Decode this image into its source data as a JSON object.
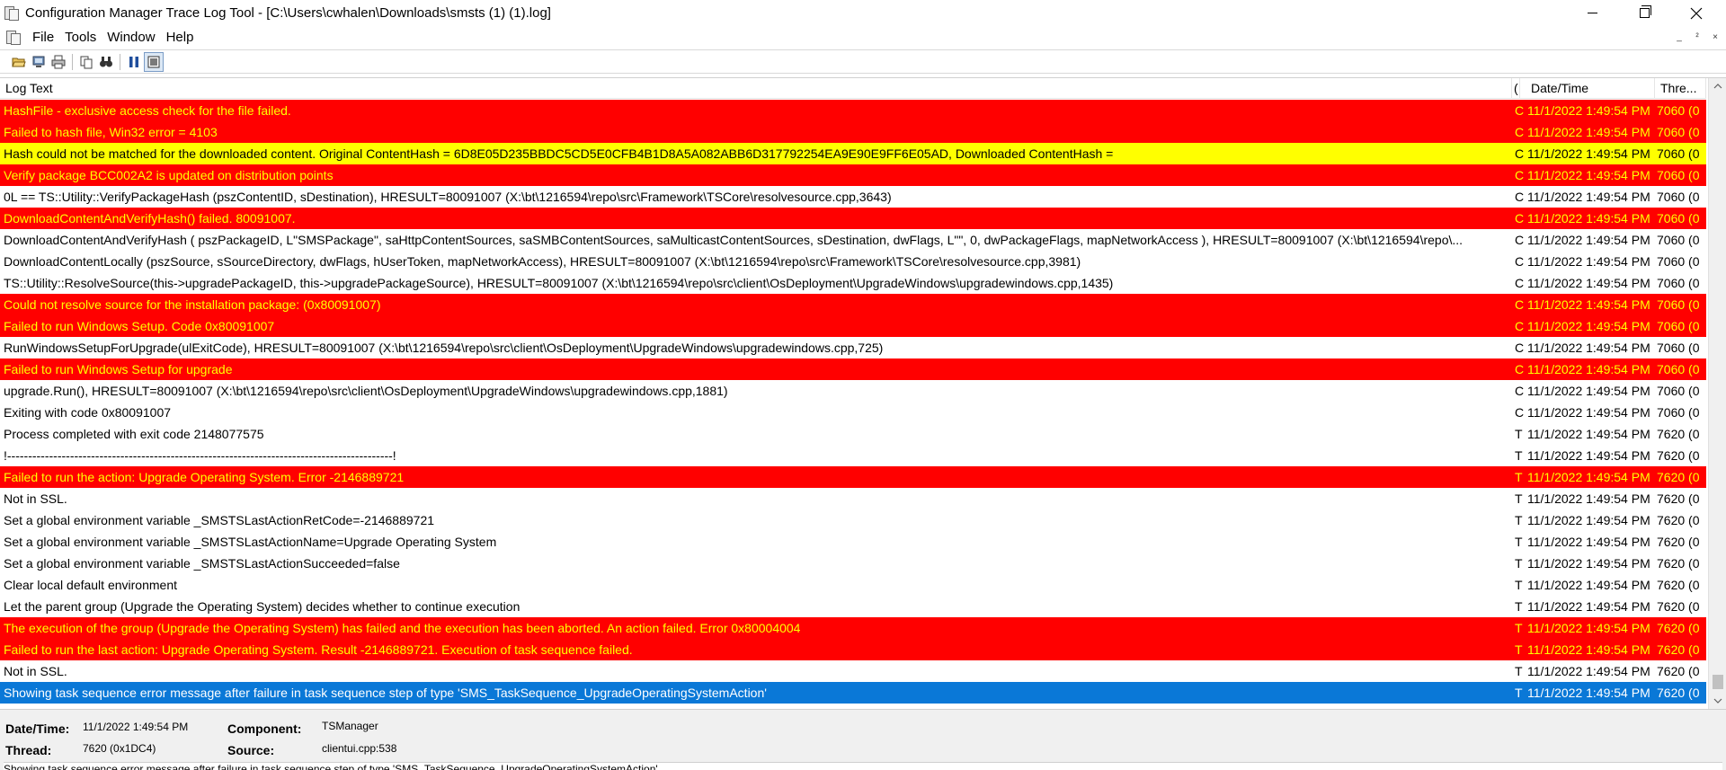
{
  "window": {
    "title": "Configuration Manager Trace Log Tool - [C:\\Users\\cwhalen\\Downloads\\smsts (1) (1).log]"
  },
  "menu": {
    "items": [
      "File",
      "Tools",
      "Window",
      "Help"
    ]
  },
  "mdi_controls": [
    "_",
    "²",
    "×"
  ],
  "toolbar": {
    "buttons": [
      "open-icon",
      "open-log-icon",
      "print-icon",
      "copy-icon",
      "find-icon",
      "pause-icon",
      "highlight-icon"
    ]
  },
  "grid": {
    "headers": {
      "log_text": "Log Text",
      "component": "(",
      "date_time": "Date/Time",
      "thread": "Thre..."
    },
    "rows": [
      {
        "severity": "error",
        "text": "HashFile - exclusive access check for the file failed.",
        "comp": "C",
        "date": "11/1/2022 1:49:54 PM",
        "thread": "7060 (0"
      },
      {
        "severity": "error",
        "text": "Failed to hash file, Win32 error = 4103",
        "comp": "C",
        "date": "11/1/2022 1:49:54 PM",
        "thread": "7060 (0"
      },
      {
        "severity": "warning",
        "text": "Hash could not be matched for the downloaded content. Original ContentHash = 6D8E05D235BBDC5CD5E0CFB4B1D8A5A082ABB6D317792254EA9E90E9FF6E05AD, Downloaded ContentHash =",
        "comp": "C",
        "date": "11/1/2022 1:49:54 PM",
        "thread": "7060 (0"
      },
      {
        "severity": "error",
        "text": "Verify package BCC002A2 is updated on distribution points",
        "comp": "C",
        "date": "11/1/2022 1:49:54 PM",
        "thread": "7060 (0"
      },
      {
        "severity": "normal",
        "text": "0L == TS::Utility::VerifyPackageHash (pszContentID, sDestination), HRESULT=80091007 (X:\\bt\\1216594\\repo\\src\\Framework\\TSCore\\resolvesource.cpp,3643)",
        "comp": "C",
        "date": "11/1/2022 1:49:54 PM",
        "thread": "7060 (0"
      },
      {
        "severity": "error",
        "text": "DownloadContentAndVerifyHash() failed. 80091007.",
        "comp": "C",
        "date": "11/1/2022 1:49:54 PM",
        "thread": "7060 (0"
      },
      {
        "severity": "normal",
        "text": "DownloadContentAndVerifyHash ( pszPackageID, L\"SMSPackage\", saHttpContentSources, saSMBContentSources, saMulticastContentSources, sDestination, dwFlags, L\"\", 0, dwPackageFlags, mapNetworkAccess ), HRESULT=80091007 (X:\\bt\\1216594\\repo\\...",
        "comp": "C",
        "date": "11/1/2022 1:49:54 PM",
        "thread": "7060 (0"
      },
      {
        "severity": "normal",
        "text": "DownloadContentLocally (pszSource, sSourceDirectory, dwFlags, hUserToken, mapNetworkAccess), HRESULT=80091007 (X:\\bt\\1216594\\repo\\src\\Framework\\TSCore\\resolvesource.cpp,3981)",
        "comp": "C",
        "date": "11/1/2022 1:49:54 PM",
        "thread": "7060 (0"
      },
      {
        "severity": "normal",
        "text": "TS::Utility::ResolveSource(this->upgradePackageID, this->upgradePackageSource), HRESULT=80091007 (X:\\bt\\1216594\\repo\\src\\client\\OsDeployment\\UpgradeWindows\\upgradewindows.cpp,1435)",
        "comp": "C",
        "date": "11/1/2022 1:49:54 PM",
        "thread": "7060 (0"
      },
      {
        "severity": "error",
        "text": "Could not resolve source for the installation package: (0x80091007)",
        "comp": "C",
        "date": "11/1/2022 1:49:54 PM",
        "thread": "7060 (0"
      },
      {
        "severity": "error",
        "text": "Failed to run Windows Setup. Code 0x80091007",
        "comp": "C",
        "date": "11/1/2022 1:49:54 PM",
        "thread": "7060 (0"
      },
      {
        "severity": "normal",
        "text": "RunWindowsSetupForUpgrade(ulExitCode), HRESULT=80091007 (X:\\bt\\1216594\\repo\\src\\client\\OsDeployment\\UpgradeWindows\\upgradewindows.cpp,725)",
        "comp": "C",
        "date": "11/1/2022 1:49:54 PM",
        "thread": "7060 (0"
      },
      {
        "severity": "error",
        "text": "Failed to run Windows Setup for upgrade",
        "comp": "C",
        "date": "11/1/2022 1:49:54 PM",
        "thread": "7060 (0"
      },
      {
        "severity": "normal",
        "text": "upgrade.Run(), HRESULT=80091007 (X:\\bt\\1216594\\repo\\src\\client\\OsDeployment\\UpgradeWindows\\upgradewindows.cpp,1881)",
        "comp": "C",
        "date": "11/1/2022 1:49:54 PM",
        "thread": "7060 (0"
      },
      {
        "severity": "normal",
        "text": "Exiting with code 0x80091007",
        "comp": "C",
        "date": "11/1/2022 1:49:54 PM",
        "thread": "7060 (0"
      },
      {
        "severity": "normal",
        "text": "Process completed with exit code 2148077575",
        "comp": "T",
        "date": "11/1/2022 1:49:54 PM",
        "thread": "7620 (0"
      },
      {
        "severity": "normal",
        "text": "!--------------------------------------------------------------------------------------------!",
        "comp": "T",
        "date": "11/1/2022 1:49:54 PM",
        "thread": "7620 (0"
      },
      {
        "severity": "error",
        "text": "Failed to run the action: Upgrade Operating System. Error -2146889721",
        "comp": "T",
        "date": "11/1/2022 1:49:54 PM",
        "thread": "7620 (0"
      },
      {
        "severity": "normal",
        "text": "Not in SSL.",
        "comp": "T",
        "date": "11/1/2022 1:49:54 PM",
        "thread": "7620 (0"
      },
      {
        "severity": "normal",
        "text": "Set a global environment variable _SMSTSLastActionRetCode=-2146889721",
        "comp": "T",
        "date": "11/1/2022 1:49:54 PM",
        "thread": "7620 (0"
      },
      {
        "severity": "normal",
        "text": "Set a global environment variable _SMSTSLastActionName=Upgrade Operating System",
        "comp": "T",
        "date": "11/1/2022 1:49:54 PM",
        "thread": "7620 (0"
      },
      {
        "severity": "normal",
        "text": "Set a global environment variable _SMSTSLastActionSucceeded=false",
        "comp": "T",
        "date": "11/1/2022 1:49:54 PM",
        "thread": "7620 (0"
      },
      {
        "severity": "normal",
        "text": "Clear local default environment",
        "comp": "T",
        "date": "11/1/2022 1:49:54 PM",
        "thread": "7620 (0"
      },
      {
        "severity": "normal",
        "text": "Let the parent group (Upgrade the Operating System) decides whether to continue execution",
        "comp": "T",
        "date": "11/1/2022 1:49:54 PM",
        "thread": "7620 (0"
      },
      {
        "severity": "error",
        "text": "The execution of the group (Upgrade the Operating System) has failed and the execution has been aborted. An action failed. Error 0x80004004",
        "comp": "T",
        "date": "11/1/2022 1:49:54 PM",
        "thread": "7620 (0"
      },
      {
        "severity": "error",
        "text": "Failed to run the last action: Upgrade Operating System. Result -2146889721. Execution of task sequence failed.",
        "comp": "T",
        "date": "11/1/2022 1:49:54 PM",
        "thread": "7620 (0"
      },
      {
        "severity": "normal",
        "text": "Not in SSL.",
        "comp": "T",
        "date": "11/1/2022 1:49:54 PM",
        "thread": "7620 (0"
      },
      {
        "severity": "selected",
        "text": "Showing task sequence error message after failure in task sequence step of type 'SMS_TaskSequence_UpgradeOperatingSystemAction'",
        "comp": "T",
        "date": "11/1/2022 1:49:54 PM",
        "thread": "7620 (0"
      }
    ]
  },
  "details": {
    "date_time_label": "Date/Time:",
    "date_time_value": "11/1/2022 1:49:54 PM",
    "component_label": "Component:",
    "component_value": "TSManager",
    "thread_label": "Thread:",
    "thread_value": "7620 (0x1DC4)",
    "source_label": "Source:",
    "source_value": "clientui.cpp:538",
    "message": "Showing task sequence error message after failure in task sequence step of type 'SMS_TaskSequence_UpgradeOperatingSystemAction'"
  },
  "colors": {
    "error_bg": "#ff0000",
    "error_fg": "#ffff00",
    "warning_bg": "#ffff00",
    "selected_bg": "#0a78d7"
  }
}
